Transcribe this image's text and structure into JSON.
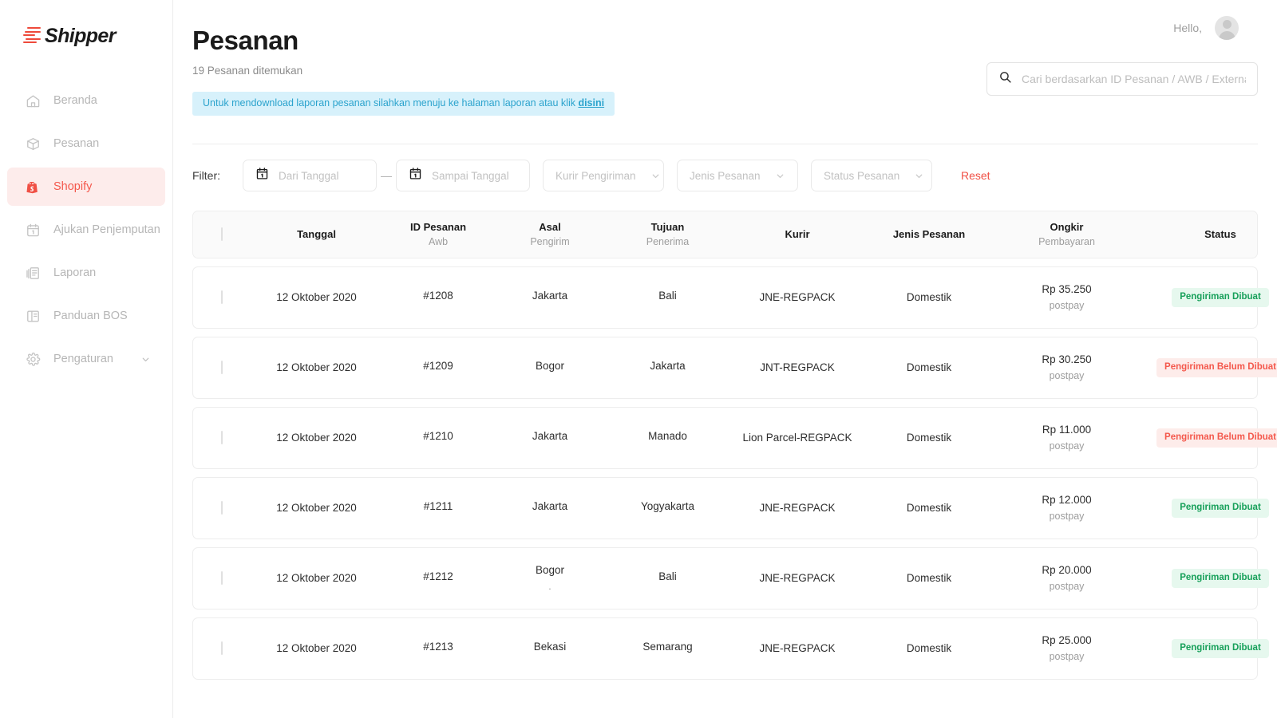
{
  "brand": {
    "name": "Shipper",
    "logo_icon": "shipper-stripes-logo"
  },
  "sidebar": {
    "items": [
      {
        "label": "Beranda",
        "icon": "home-icon",
        "active": false
      },
      {
        "label": "Pesanan",
        "icon": "package-icon",
        "active": false
      },
      {
        "label": "Shopify",
        "icon": "shopify-bag-icon",
        "active": true
      },
      {
        "label": "Ajukan Penjemputan",
        "icon": "calendar-icon",
        "active": false
      },
      {
        "label": "Laporan",
        "icon": "report-icon",
        "active": false
      },
      {
        "label": "Panduan BOS",
        "icon": "book-icon",
        "active": false
      },
      {
        "label": "Pengaturan",
        "icon": "gear-icon",
        "active": false,
        "chevron": "chevron-down-icon"
      }
    ]
  },
  "topbar": {
    "greeting": "Hello,",
    "avatar_icon": "user-avatar-icon"
  },
  "page": {
    "title": "Pesanan",
    "subtitle": "19 Pesanan ditemukan",
    "banner_text": "Untuk mendownload laporan pesanan silahkan menuju ke halaman laporan atau klik ",
    "banner_link": "disini"
  },
  "search": {
    "placeholder": "Cari berdasarkan ID Pesanan / AWB / External ID",
    "value": "",
    "icon": "search-icon"
  },
  "filter": {
    "label": "Filter:",
    "date_from_placeholder": "Dari Tanggal",
    "date_from_value": "",
    "date_to_placeholder": "Sampai Tanggal",
    "date_to_value": "",
    "range_separator": "—",
    "courier_placeholder": "Kurir Pengiriman",
    "order_type_placeholder": "Jenis Pesanan",
    "order_status_placeholder": "Status Pesanan",
    "reset_label": "Reset",
    "calendar_icon": "calendar-icon",
    "chevron_icon": "chevron-down-icon"
  },
  "table": {
    "columns": [
      {
        "main": "",
        "sub": ""
      },
      {
        "main": "Tanggal",
        "sub": ""
      },
      {
        "main": "ID Pesanan",
        "sub": "Awb"
      },
      {
        "main": "Asal",
        "sub": "Pengirim"
      },
      {
        "main": "Tujuan",
        "sub": "Penerima"
      },
      {
        "main": "Kurir",
        "sub": ""
      },
      {
        "main": "Jenis Pesanan",
        "sub": ""
      },
      {
        "main": "Ongkir",
        "sub": "Pembayaran"
      },
      {
        "main": "Status",
        "sub": ""
      }
    ],
    "rows": [
      {
        "tanggal": "12 Oktober 2020",
        "id_pesanan": "#1208",
        "awb": "",
        "asal": "Jakarta",
        "pengirim": "",
        "tujuan": "Bali",
        "penerima": "",
        "kurir": "JNE-REGPACK",
        "jenis": "Domestik",
        "ongkir": "Rp 35.250",
        "pembayaran": "postpay",
        "status": "Pengiriman Dibuat",
        "status_type": "green"
      },
      {
        "tanggal": "12 Oktober 2020",
        "id_pesanan": "#1209",
        "awb": "",
        "asal": "Bogor",
        "pengirim": "",
        "tujuan": "Jakarta",
        "penerima": "",
        "kurir": "JNT-REGPACK",
        "jenis": "Domestik",
        "ongkir": "Rp 30.250",
        "pembayaran": "postpay",
        "status": "Pengiriman Belum Dibuat",
        "status_type": "red"
      },
      {
        "tanggal": "12 Oktober 2020",
        "id_pesanan": "#1210",
        "awb": "",
        "asal": "Jakarta",
        "pengirim": "",
        "tujuan": "Manado",
        "penerima": "",
        "kurir": "Lion Parcel-REGPACK",
        "jenis": "Domestik",
        "ongkir": "Rp 11.000",
        "pembayaran": "postpay",
        "status": "Pengiriman Belum Dibuat",
        "status_type": "red"
      },
      {
        "tanggal": "12 Oktober 2020",
        "id_pesanan": "#1211",
        "awb": "",
        "asal": "Jakarta",
        "pengirim": "",
        "tujuan": "Yogyakarta",
        "penerima": "",
        "kurir": "JNE-REGPACK",
        "jenis": "Domestik",
        "ongkir": "Rp 12.000",
        "pembayaran": "postpay",
        "status": "Pengiriman Dibuat",
        "status_type": "green"
      },
      {
        "tanggal": "12 Oktober 2020",
        "id_pesanan": "#1212",
        "awb": "",
        "asal": "Bogor",
        "pengirim": ".",
        "tujuan": "Bali",
        "penerima": "",
        "kurir": "JNE-REGPACK",
        "jenis": "Domestik",
        "ongkir": "Rp 20.000",
        "pembayaran": "postpay",
        "status": "Pengiriman Dibuat",
        "status_type": "green"
      },
      {
        "tanggal": "12 Oktober 2020",
        "id_pesanan": "#1213",
        "awb": "",
        "asal": "Bekasi",
        "pengirim": "",
        "tujuan": "Semarang",
        "penerima": "",
        "kurir": "JNE-REGPACK",
        "jenis": "Domestik",
        "ongkir": "Rp 25.000",
        "pembayaran": "postpay",
        "status": "Pengiriman Dibuat",
        "status_type": "green"
      }
    ]
  },
  "colors": {
    "brand_red": "#ee4a3b",
    "active_red": "#f4584c",
    "active_bg": "#fdeceb",
    "banner_bg": "#d7f1fb",
    "banner_text": "#2ba3cd",
    "badge_green_text": "#17a05a",
    "badge_green_bg": "#e6f8ee",
    "badge_red_text": "#f4584c",
    "badge_red_bg": "#fdecea"
  }
}
